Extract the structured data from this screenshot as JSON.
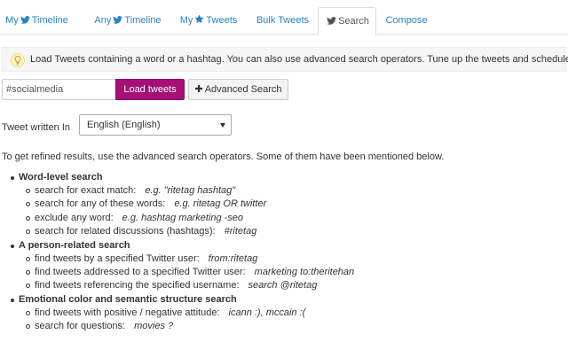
{
  "tabs": [
    {
      "prefix": "My",
      "icon": "twitter-bird-icon",
      "suffix": "Timeline",
      "active": false
    },
    {
      "prefix": "Any",
      "icon": "twitter-bird-icon",
      "suffix": "Timeline",
      "active": false
    },
    {
      "prefix": "My",
      "icon": "star-icon",
      "suffix": "Tweets",
      "active": false
    },
    {
      "prefix": "",
      "icon": "",
      "suffix": "Bulk Tweets",
      "active": false
    },
    {
      "prefix": "",
      "icon": "twitter-bird-icon",
      "suffix": "Search",
      "active": true
    },
    {
      "prefix": "",
      "icon": "",
      "suffix": "Compose",
      "active": false
    }
  ],
  "info": {
    "icon": "lightbulb-icon",
    "text": "Load Tweets containing a word or a hashtag. You can also use advanced search operators. Tune up the tweets and schedule."
  },
  "search": {
    "value": "#socialmedia",
    "load_label": "Load tweets",
    "advanced_label": "Advanced Search"
  },
  "language": {
    "label": "Tweet written In",
    "selected": "English (English)"
  },
  "intro": "To get refined results, use the advanced search operators. Some of them have been mentioned below.",
  "sections": [
    {
      "title": "Word-level search",
      "items": [
        {
          "text": "search for exact match:",
          "example": "e.g. \"ritetag hashtag\""
        },
        {
          "text": "search for any of these words:",
          "example": "e.g. ritetag OR twitter"
        },
        {
          "text": "exclude any word:",
          "example": "e.g. hashtag marketing -seo"
        },
        {
          "text": "search for related discussions (hashtags):",
          "example": "#ritetag"
        }
      ]
    },
    {
      "title": "A person-related search",
      "items": [
        {
          "text": "find tweets by a specified Twitter user:",
          "example": "from:ritetag"
        },
        {
          "text": "find tweets addressed to a specified Twitter user:",
          "example": "marketing to:theritehan"
        },
        {
          "text": "find tweets referencing the specified username:",
          "example": "search @ritetag"
        }
      ]
    },
    {
      "title": "Emotional color and semantic structure search",
      "items": [
        {
          "text": "find tweets with positive / negative attitude:",
          "example": "icann :), mccain :("
        },
        {
          "text": "search for questions:",
          "example": "movies ?"
        }
      ]
    }
  ],
  "colors": {
    "link": "#2a84c4",
    "primary_button": "#a50f77"
  }
}
